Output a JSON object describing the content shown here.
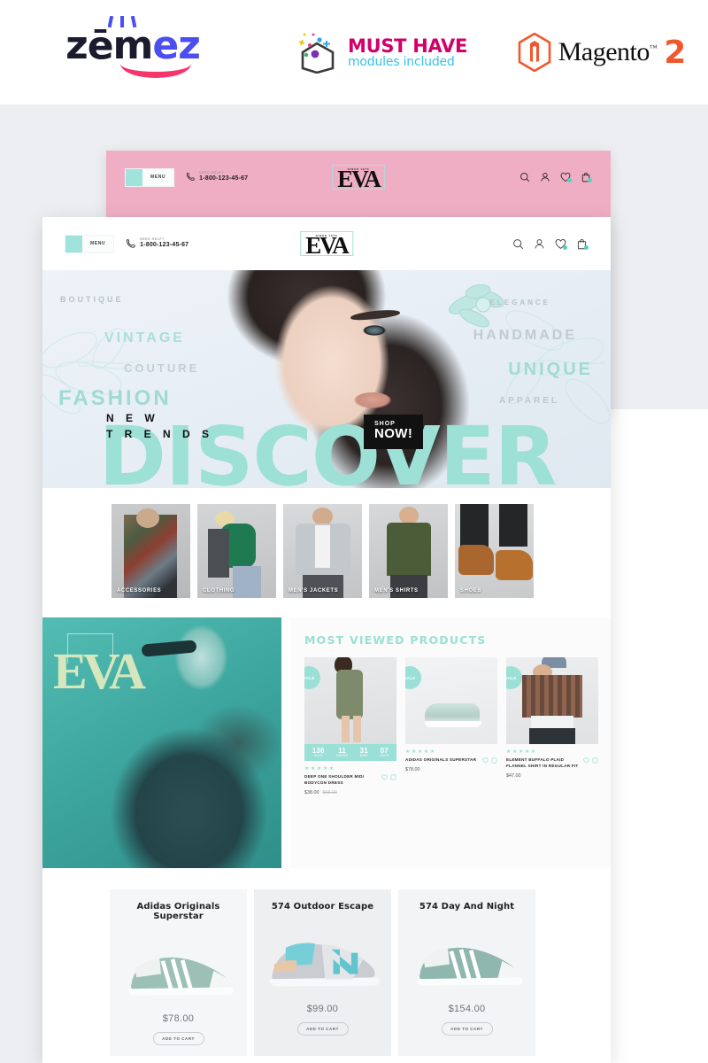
{
  "brandbar": {
    "zemez": {
      "part1": "zēm",
      "part2": "ez",
      "name": "zemez-logo"
    },
    "musthave": {
      "title": "MUST HAVE",
      "subtitle": "modules included"
    },
    "magento": {
      "name": "Magento",
      "version": "2",
      "tm": "™"
    }
  },
  "colors": {
    "mint": "#9ae0d7",
    "pink": "#f0aec4",
    "magenta": "#d1006b",
    "cyan": "#36c3e8",
    "orange": "#f1572b",
    "blue": "#4b4ef0",
    "navy": "#1b1b2f",
    "hot_pink": "#f6356c",
    "teal_banner": "#3ea79f"
  },
  "site_header": {
    "menu_label": "MENU",
    "need_help": "NEED HELP?",
    "phone": "1-800-123-45-67",
    "logo_since": "SINCE 1976",
    "logo_text": "EVA",
    "icons": [
      "search-icon",
      "account-icon",
      "wishlist-icon",
      "cart-icon"
    ]
  },
  "hero": {
    "keywords_left": [
      "BOUTIQUE",
      "VINTAGE",
      "COUTURE",
      "FASHION"
    ],
    "keywords_right": [
      "ELEGANCE",
      "HANDMADE",
      "UNIQUE",
      "APPAREL"
    ],
    "headline": "DISCOVER",
    "subline_1": "N E W",
    "subline_2": "T R E N D S",
    "cta_small": "SHOP",
    "cta_large": "NOW!"
  },
  "categories": [
    {
      "label": "ACCESSORIES"
    },
    {
      "label": "CLOTHING"
    },
    {
      "label": "MEN'S JACKETS"
    },
    {
      "label": "MEN'S SHIRTS"
    },
    {
      "label": "SHOES"
    }
  ],
  "mid_banner": {
    "logo_text": "EVA"
  },
  "most_viewed": {
    "title": "MOST VIEWED PRODUCTS",
    "sale_badge": "SALE",
    "stars": "★★★★★",
    "timer": {
      "days": {
        "value": "136",
        "label": "DAYS"
      },
      "hours": {
        "value": "11",
        "label": "HOURS"
      },
      "mins": {
        "value": "31",
        "label": "MINS"
      },
      "secs": {
        "value": "07",
        "label": "SECS"
      }
    },
    "products": [
      {
        "name": "DEEP ONE SHOULDER MIDI BODYCON DRESS",
        "price": "$38.00",
        "old_price": "$68.00"
      },
      {
        "name": "ADIDAS ORIGINALS SUPERSTAR",
        "price": "$78.00",
        "old_price": ""
      },
      {
        "name": "ELEMENT BUFFALO PLAID FLANNEL SHIRT IN REGULAR FIT",
        "price": "$47.00",
        "old_price": ""
      }
    ]
  },
  "bottom_products": [
    {
      "name": "Adidas Originals Superstar",
      "price": "$78.00",
      "button": "ADD TO CART"
    },
    {
      "name": "574 Outdoor Escape",
      "price": "$99.00",
      "button": "ADD TO CART"
    },
    {
      "name": "574 Day And Night",
      "price": "$154.00",
      "button": "ADD TO CART"
    }
  ]
}
